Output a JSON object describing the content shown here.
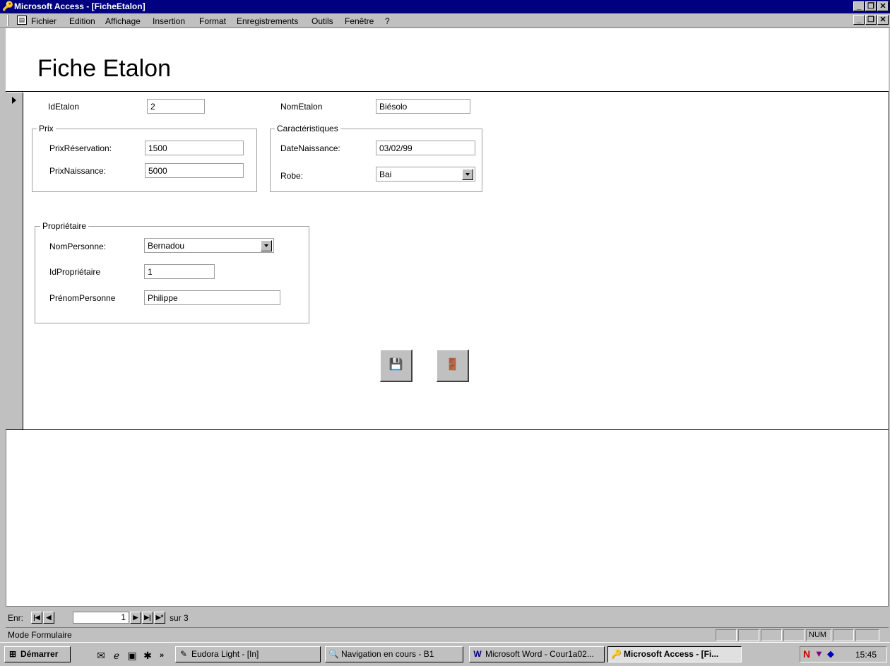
{
  "window": {
    "title": "Microsoft Access - [FicheEtalon]"
  },
  "menu": {
    "items": [
      "Fichier",
      "Edition",
      "Affichage",
      "Insertion",
      "Format",
      "Enregistrements",
      "Outils",
      "Fenêtre",
      "?"
    ]
  },
  "form": {
    "title": "Fiche Etalon",
    "fields": {
      "id_etalon": {
        "label": "IdEtalon",
        "value": "2"
      },
      "nom_etalon": {
        "label": "NomEtalon",
        "value": "Biésolo"
      }
    },
    "prix": {
      "label": "Prix",
      "reservation": {
        "label": "PrixRéservation:",
        "value": "1500"
      },
      "naissance": {
        "label": "PrixNaissance:",
        "value": "5000"
      }
    },
    "caracteristiques": {
      "label": "Caractéristiques",
      "date_naissance": {
        "label": "DateNaissance:",
        "value": "03/02/99"
      },
      "robe": {
        "label": "Robe:",
        "value": "Bai"
      }
    },
    "proprietaire": {
      "label": "Propriétaire",
      "nom_personne": {
        "label": "NomPersonne:",
        "value": "Bernadou"
      },
      "id_proprietaire": {
        "label": "IdPropriétaire",
        "value": "1"
      },
      "prenom_personne": {
        "label": "PrénomPersonne",
        "value": "Philippe"
      }
    },
    "buttons": {
      "save_icon": "save-icon",
      "exit_icon": "exit-door-icon"
    }
  },
  "navigation": {
    "label": "Enr:",
    "current": "1",
    "total_label": "sur  3"
  },
  "status": {
    "mode": "Mode Formulaire",
    "num": "NUM"
  },
  "taskbar": {
    "start": "Démarrer",
    "tasks": [
      {
        "label": "Eudora Light - [In]"
      },
      {
        "label": "Navigation en cours - B1"
      },
      {
        "label": "Microsoft Word - Cour1a02..."
      },
      {
        "label": "Microsoft Access - [Fi..."
      }
    ],
    "clock": "15:45"
  }
}
